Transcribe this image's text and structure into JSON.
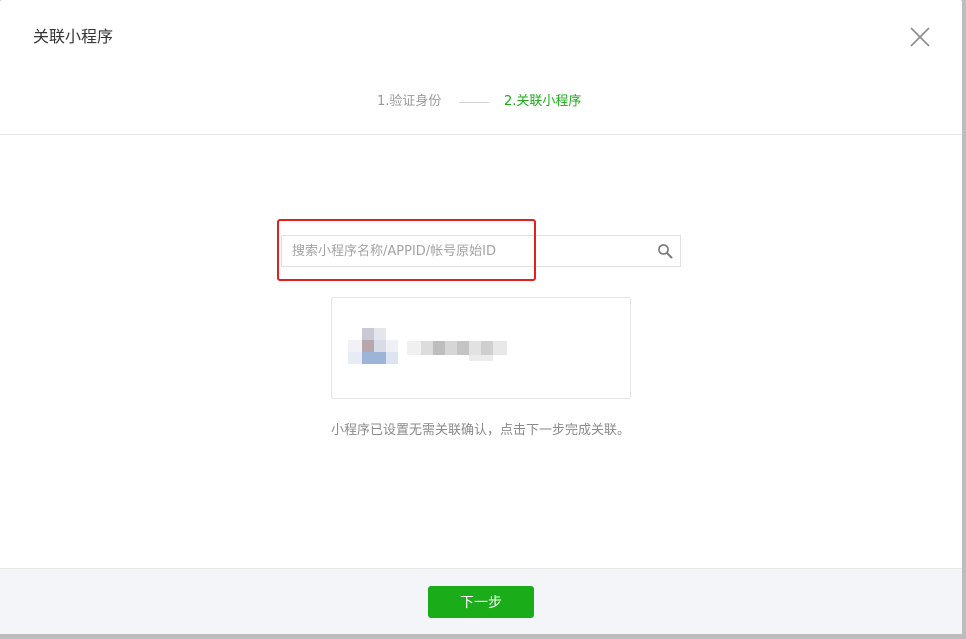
{
  "dialog": {
    "title": "关联小程序"
  },
  "steps": [
    {
      "label": "1.验证身份",
      "state": "done"
    },
    {
      "label": "2.关联小程序",
      "state": "active"
    }
  ],
  "search": {
    "placeholder": "搜索小程序名称/APPID/帐号原始ID",
    "value": ""
  },
  "result": {
    "avatar": "blurred-avatar",
    "name": "blurred"
  },
  "tip": "小程序已设置无需关联确认，点击下一步完成关联。",
  "footer": {
    "next_label": "下一步"
  },
  "colors": {
    "accent": "#1aad19",
    "highlight": "#e32020",
    "muted": "#9a9a9a"
  }
}
